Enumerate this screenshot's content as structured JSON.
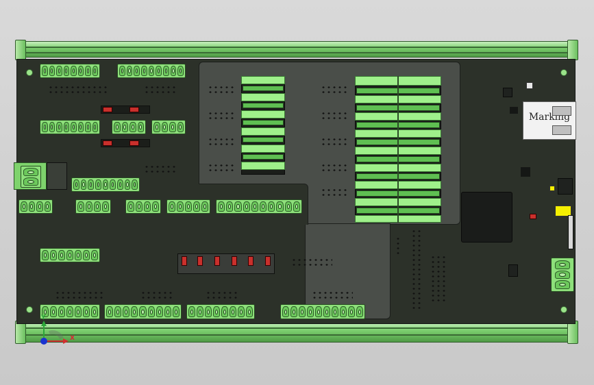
{
  "pcb": {
    "ethernet_label": "Marking"
  },
  "triad": {
    "x_label": "X",
    "y_label": "Y"
  },
  "colors": {
    "pcb": "#2c3129",
    "heatsink": "#4a4e49",
    "terminal": "#8ee07b",
    "rail": "#7ccf6f",
    "led_red": "#c9302c",
    "led_yellow": "#f5f000"
  },
  "icons": {
    "triad": "xyz-axis-triad-icon"
  }
}
